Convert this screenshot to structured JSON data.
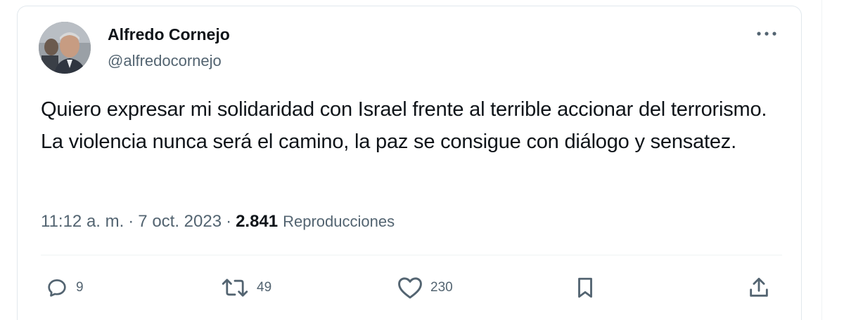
{
  "author": {
    "name": "Alfredo Cornejo",
    "handle": "@alfredocornejo"
  },
  "tweet": {
    "text": "Quiero expresar mi solidaridad con Israel frente al terrible accionar del terrorismo. La violencia nunca será el camino, la paz se consigue con diálogo y sensatez.",
    "time": "11:12 a. m.",
    "separator": "·",
    "date": "7 oct. 2023",
    "views_count": "2.841",
    "views_label": "Reproducciones"
  },
  "actions": {
    "replies": "9",
    "retweets": "49",
    "likes": "230"
  },
  "icons": {
    "more": "more-horizontal-icon",
    "reply": "reply-icon",
    "retweet": "retweet-icon",
    "like": "heart-icon",
    "bookmark": "bookmark-icon",
    "share": "share-icon"
  },
  "colors": {
    "text_primary": "#0f1419",
    "text_secondary": "#536471",
    "border": "#e1e8ed",
    "divider": "#eff3f4"
  }
}
